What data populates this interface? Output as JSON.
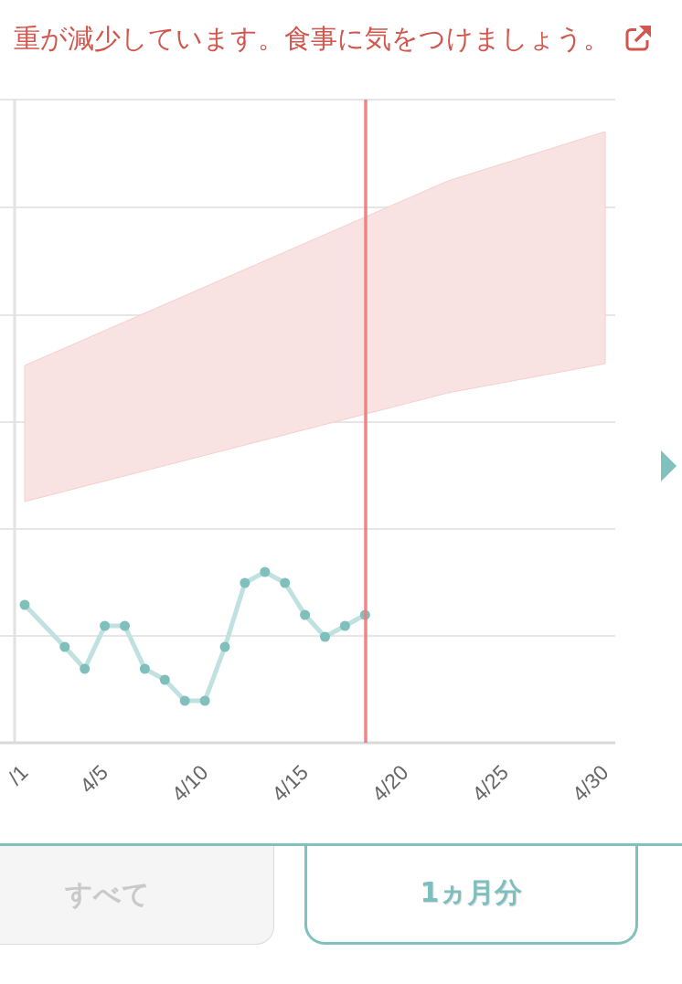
{
  "message": {
    "text": "重が減少しています。食事に気をつけましょう。"
  },
  "chart": {
    "x_labels": [
      "/1",
      "4/5",
      "4/10",
      "4/15",
      "4/20",
      "4/25",
      "4/30"
    ]
  },
  "tabs": [
    {
      "label": "すべて",
      "selected": false
    },
    {
      "label": "1ヵ月分",
      "selected": true
    }
  ]
}
